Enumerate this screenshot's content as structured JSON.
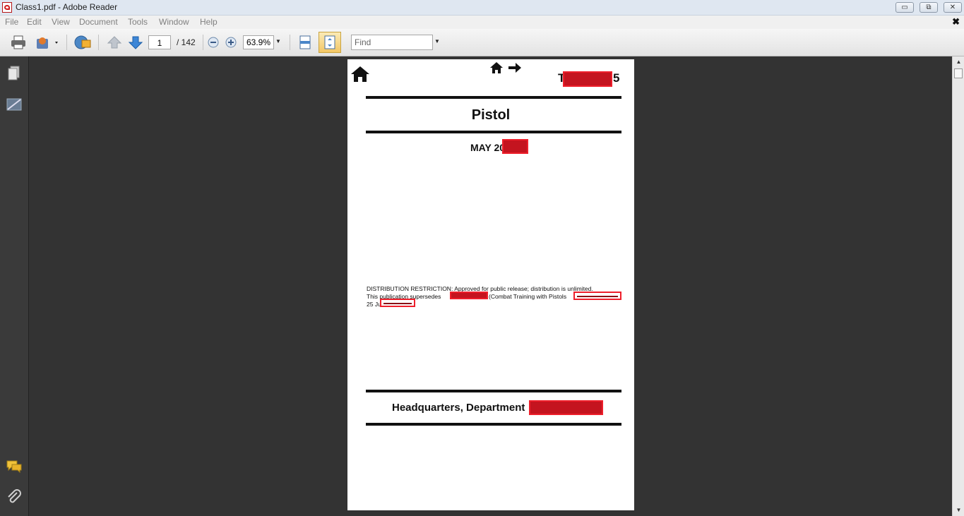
{
  "window": {
    "title": "Class1.pdf - Adobe Reader",
    "icon": "pdf-icon",
    "controls": {
      "minimize": "▭",
      "restore": "⧉",
      "close": "✕"
    }
  },
  "menu": {
    "items": [
      "File",
      "Edit",
      "View",
      "Document",
      "Tools",
      "Window",
      "Help"
    ],
    "close_glyph": "✖"
  },
  "toolbar": {
    "current_page": "1",
    "total_pages": "/ 142",
    "zoom": "63.9%",
    "find_placeholder": "Find",
    "icons": [
      "print-icon",
      "collaborate-icon",
      "share-icon",
      "previous-page-icon",
      "next-page-icon",
      "zoom-out-icon",
      "zoom-in-icon",
      "fit-width-icon",
      "fit-page-icon"
    ]
  },
  "leftnav": {
    "icons": [
      "pages-icon",
      "signatures-icon",
      "comments-icon",
      "attachments-icon"
    ]
  },
  "document": {
    "header_suffix": "5",
    "title": "Pistol",
    "date": "MAY 20",
    "dist_line1": "DISTRIBUTION RESTRICTION: Approved for public release; distribution is unlimited.",
    "dist_line2a": "This publication supersedes",
    "dist_line2b": "(Combat Training with Pistols",
    "dist_line3": "25 Ju",
    "publisher": "Headquarters, Department"
  },
  "colors": {
    "redaction": "#c4141f",
    "redaction_border": "#ee1f2b",
    "workspace": "#333333"
  }
}
